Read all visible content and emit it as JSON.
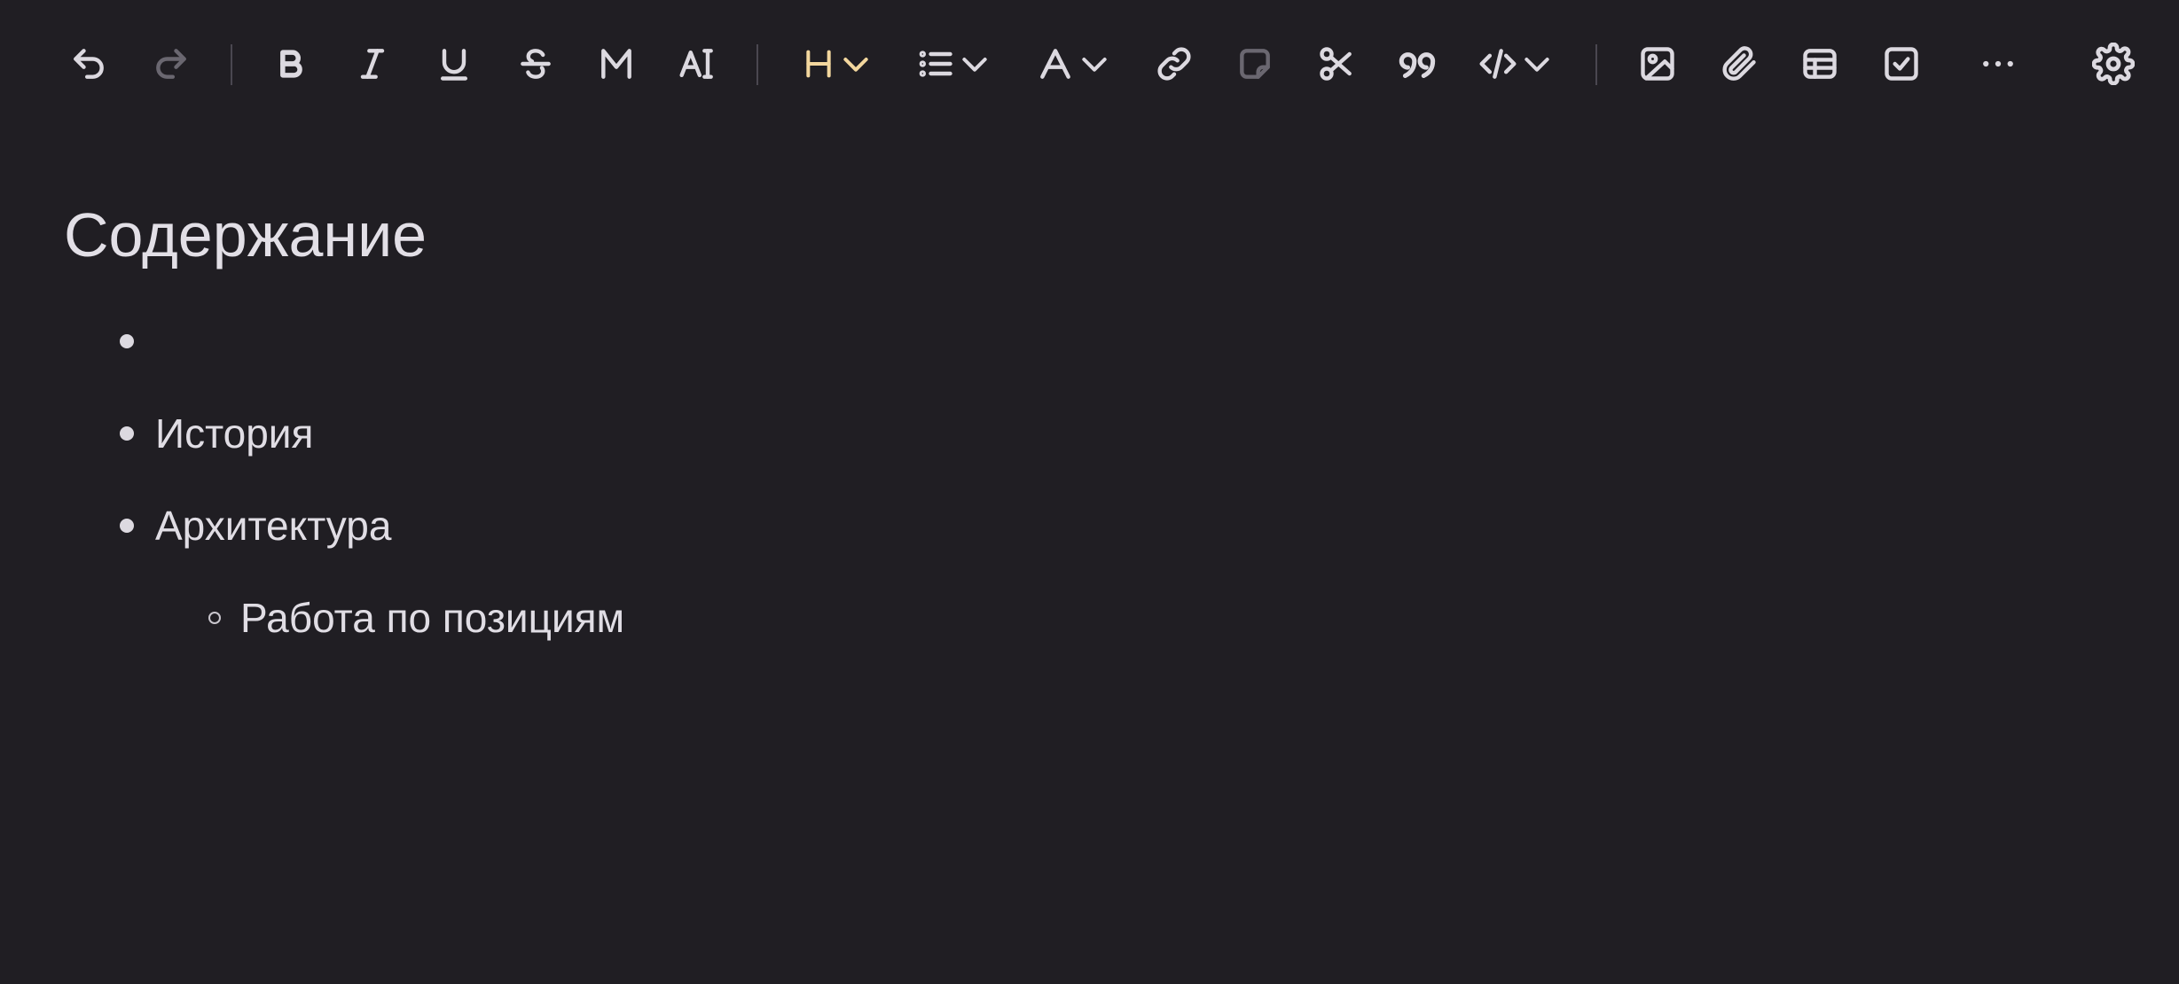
{
  "toolbar": {
    "items": [
      {
        "name": "undo"
      },
      {
        "name": "redo",
        "state": "disabled"
      },
      {
        "name": "bold",
        "glyph": "B"
      },
      {
        "name": "italic"
      },
      {
        "name": "underline"
      },
      {
        "name": "strikethrough"
      },
      {
        "name": "highlight-mark"
      },
      {
        "name": "clear-formatting"
      },
      {
        "name": "heading",
        "glyph": "H",
        "state": "active"
      },
      {
        "name": "list"
      },
      {
        "name": "font",
        "glyph": "A"
      },
      {
        "name": "link"
      },
      {
        "name": "sticky-note",
        "state": "disabled"
      },
      {
        "name": "cut"
      },
      {
        "name": "quote"
      },
      {
        "name": "code"
      },
      {
        "name": "image"
      },
      {
        "name": "attachment"
      },
      {
        "name": "table"
      },
      {
        "name": "checkbox"
      },
      {
        "name": "more"
      },
      {
        "name": "settings"
      }
    ],
    "colors": {
      "icon": "#dcd9e0",
      "disabled": "#6a6770",
      "accent": "#f3d79e"
    }
  },
  "document": {
    "heading": "Содержание",
    "list": [
      {
        "text": ""
      },
      {
        "text": "История"
      },
      {
        "text": "Архитектура"
      },
      {
        "text": "Работа по позициям"
      }
    ]
  },
  "colors": {
    "background": "#201e23",
    "text": "#e0dde4"
  }
}
